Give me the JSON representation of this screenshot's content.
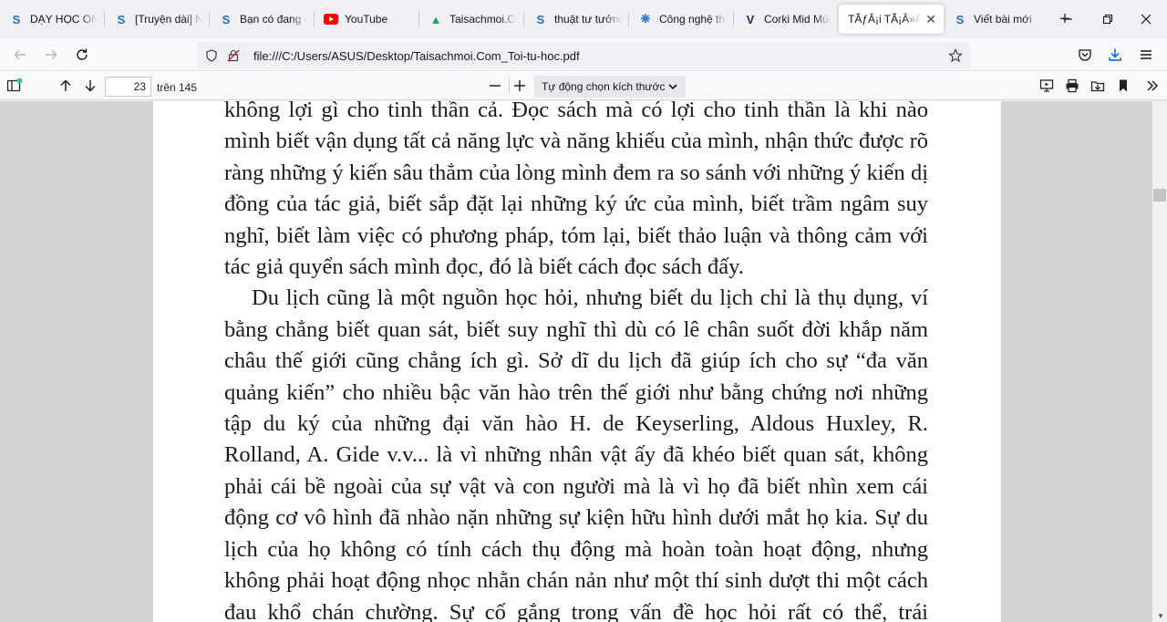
{
  "tabs": [
    {
      "title": "DẠY HỌC ONLINE",
      "icon": "s-logo-icon",
      "color": "#1f6fb2"
    },
    {
      "title": "[Truyện dài] Nhật ký",
      "icon": "s-logo-icon",
      "color": "#1f6fb2"
    },
    {
      "title": "Bạn có đang ở",
      "icon": "s-logo-icon",
      "color": "#1f6fb2"
    },
    {
      "title": "YouTube",
      "icon": "youtube-icon",
      "color": "#ff0000"
    },
    {
      "title": "Taisachmoi.Com",
      "icon": "google-drive-icon",
      "color": "#1fa463"
    },
    {
      "title": "thuật tư tưởng",
      "icon": "s-logo-icon",
      "color": "#1f6fb2"
    },
    {
      "title": "Công nghệ thông tin",
      "icon": "tech-logo-icon",
      "color": "#3c7bd9"
    },
    {
      "title": "Corki Mid Mùa",
      "icon": "v-logo-icon",
      "color": "#1a2a6c"
    },
    {
      "title": "TÃƒÂ¡i TÃ¡Â»Â±",
      "icon": "",
      "color": "#000"
    },
    {
      "title": "Viết bài mới",
      "icon": "s-logo-icon",
      "color": "#1f6fb2"
    }
  ],
  "active_tab_index": 8,
  "url": "file:///C:/Users/ASUS/Desktop/Taisachmoi.Com_Toi-tu-hoc.pdf",
  "pdf": {
    "page_number": "23",
    "page_count_label": "trên 145",
    "zoom_label": "Tự động chọn kích thước"
  },
  "document": {
    "paragraphs": [
      "không lợi gì cho tinh thần cả. Đọc sách mà có lợi cho tinh thần là khi nào mình biết vận dụng tất cả năng lực và năng khiếu của mình, nhận thức được rõ ràng những ý kiến sâu thẳm của lòng mình đem ra so sánh với những ý kiến dị đồng của tác giả, biết sắp đặt lại những ký ức của mình, biết trầm ngâm suy nghĩ, biết làm việc có phương pháp, tóm lại, biết thảo luận và thông cảm với tác giả quyển sách mình đọc, đó là biết cách đọc sách đấy.",
      "Du lịch cũng là một nguồn học hỏi, nhưng biết du lịch chỉ là thụ dụng, ví bằng chẳng biết quan sát, biết suy nghĩ thì dù có lê chân suốt đời khắp năm châu thế giới cũng chẳng ích gì. Sở dĩ du lịch đã giúp ích cho sự “đa văn quảng kiến” cho nhiều bậc văn hào trên thế giới như bằng chứng nơi những tập du ký của những đại văn hào H. de Keyserling, Aldous Huxley, R. Rolland, A. Gide v.v... là vì những nhân vật ấy đã khéo biết quan sát, không phải cái bề ngoài của sự vật và con người mà là vì họ đã biết nhìn xem cái động cơ vô hình đã nhào nặn những sự kiện hữu hình dưới mắt họ kia. Sự du lịch của họ không có tính cách thụ động mà hoàn toàn hoạt động, nhưng không phải hoạt động nhọc nhằn chán nản như một thí sinh dượt thi một cách đau khổ chán chường. Sự cố gắng trong vấn đề học hỏi rất có thể, trái"
    ]
  }
}
